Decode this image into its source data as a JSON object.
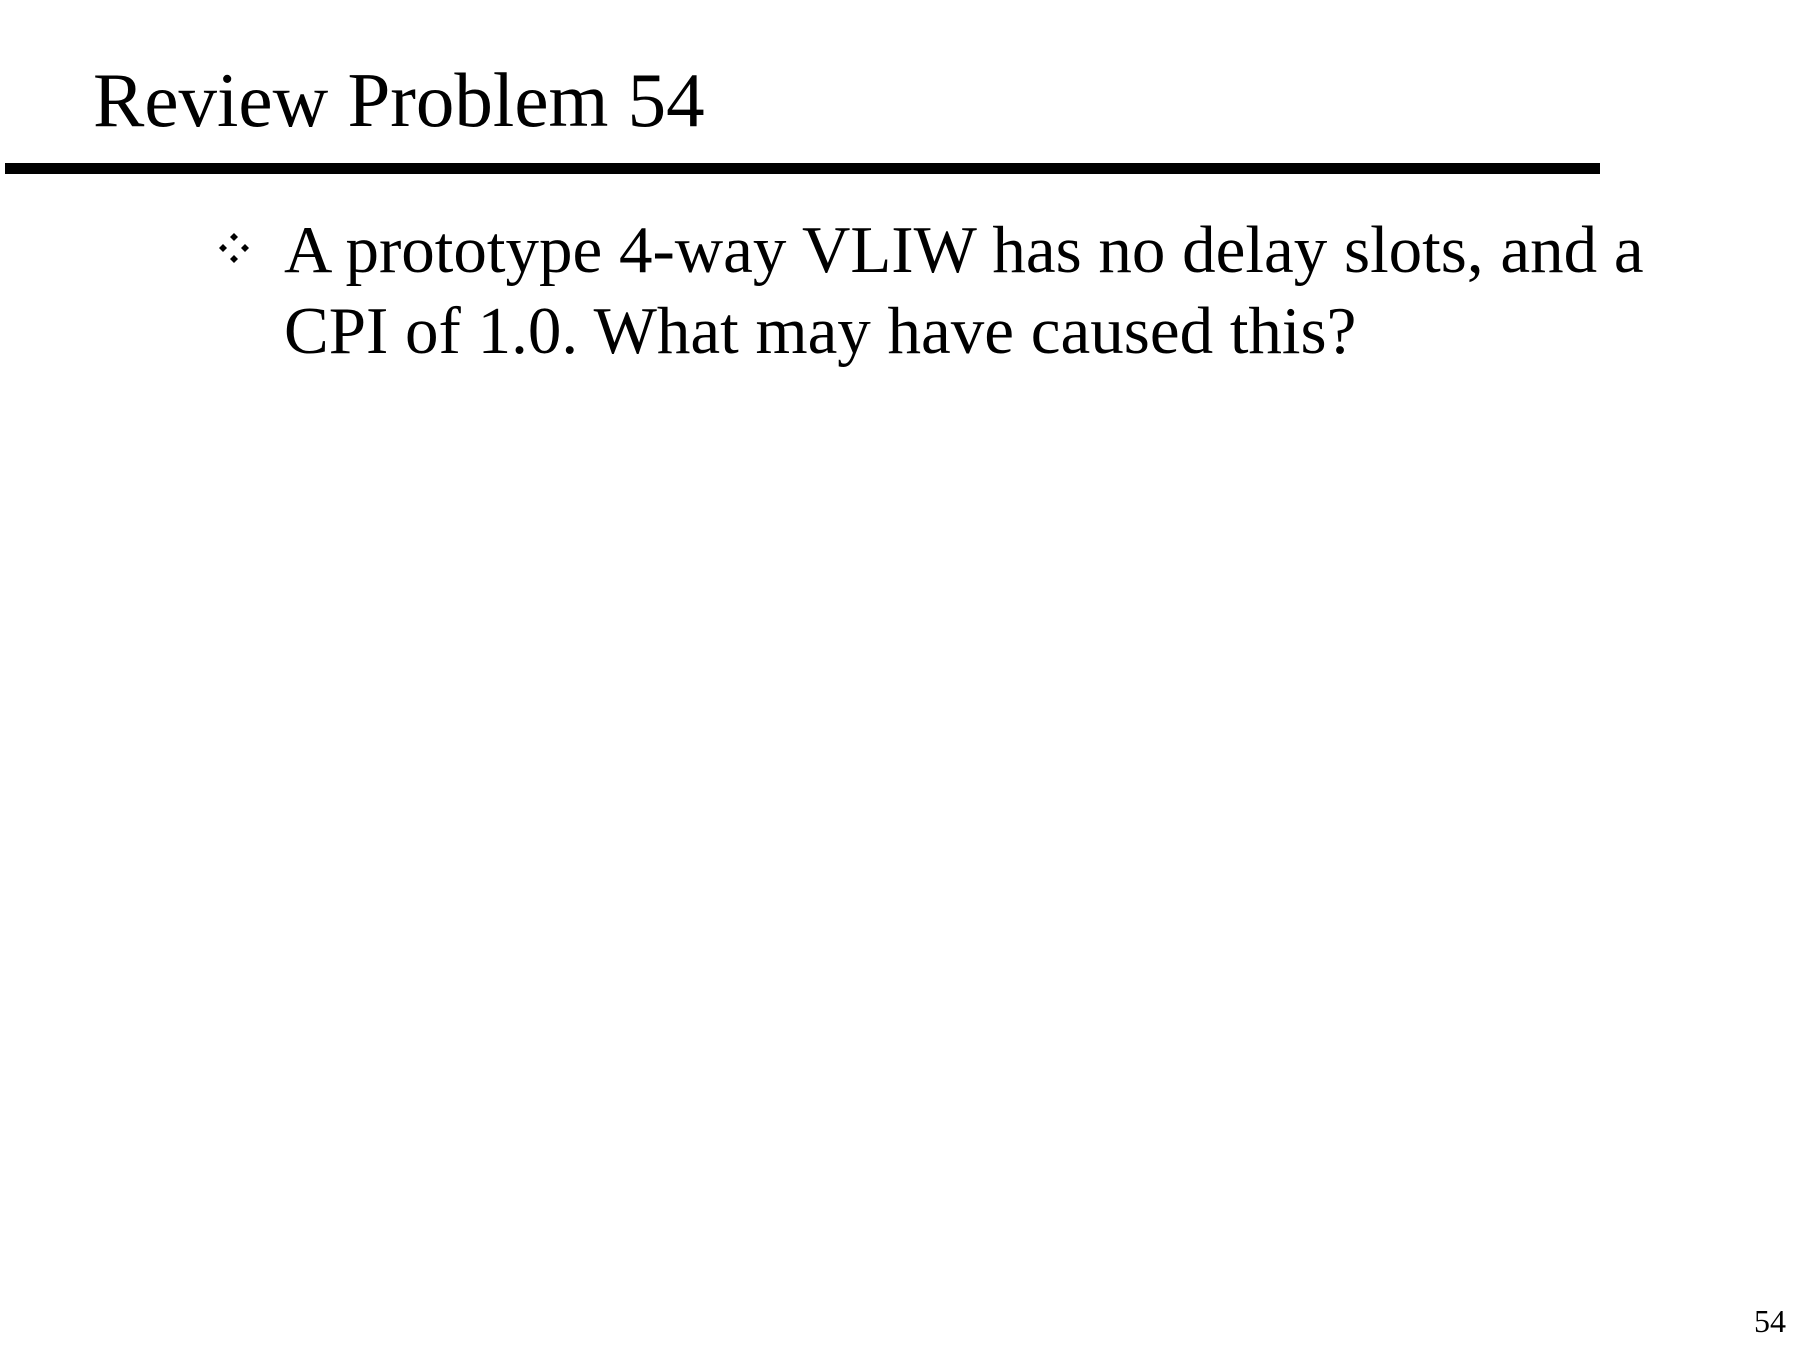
{
  "slide": {
    "title": "Review Problem 54",
    "bullets": [
      {
        "icon": "diamond-bullet-icon",
        "text": "A prototype 4-way VLIW has no delay slots, and a CPI of 1.0.  What may have caused this?"
      }
    ],
    "page_number": "54"
  }
}
